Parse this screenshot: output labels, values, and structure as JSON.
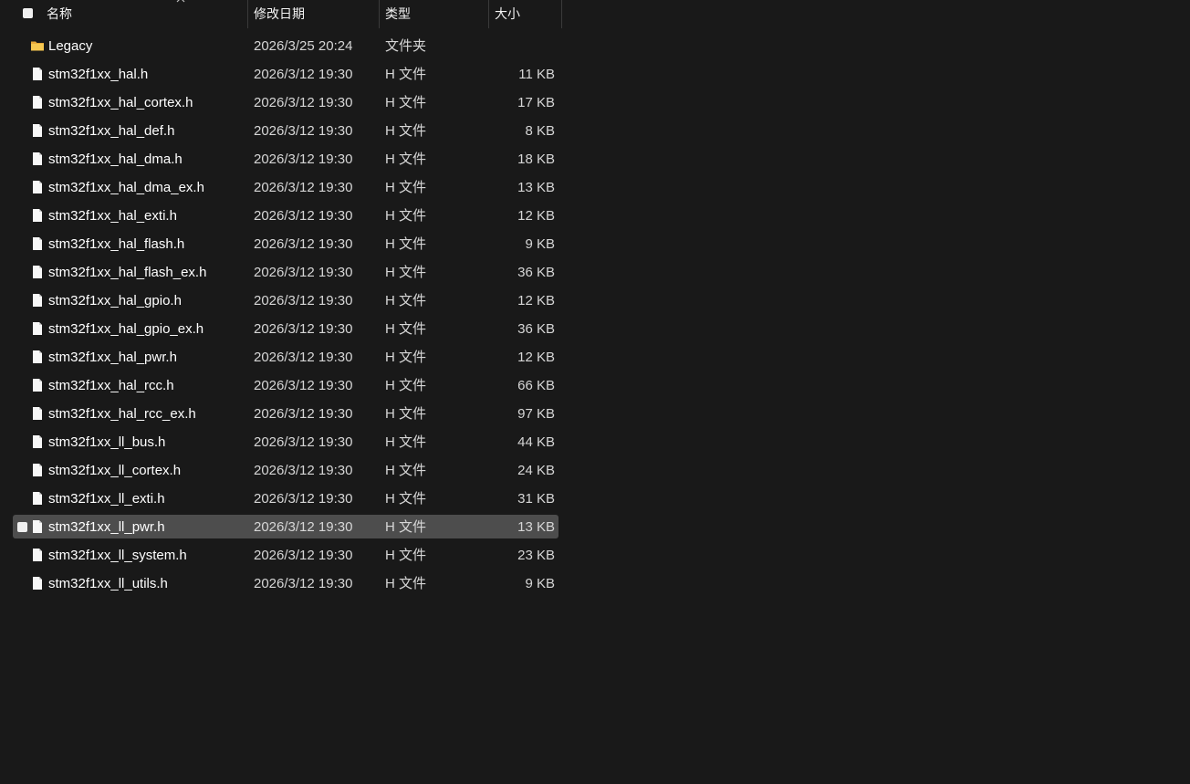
{
  "header": {
    "name": "名称",
    "date": "修改日期",
    "type": "类型",
    "size": "大小"
  },
  "rows": [
    {
      "name": "Legacy",
      "date": "2026/3/25 20:24",
      "type": "文件夹",
      "size": "",
      "icon": "folder-icon"
    },
    {
      "name": "stm32f1xx_hal.h",
      "date": "2026/3/12 19:30",
      "type": "H 文件",
      "size": "11 KB",
      "icon": "file-icon"
    },
    {
      "name": "stm32f1xx_hal_cortex.h",
      "date": "2026/3/12 19:30",
      "type": "H 文件",
      "size": "17 KB",
      "icon": "file-icon"
    },
    {
      "name": "stm32f1xx_hal_def.h",
      "date": "2026/3/12 19:30",
      "type": "H 文件",
      "size": "8 KB",
      "icon": "file-icon"
    },
    {
      "name": "stm32f1xx_hal_dma.h",
      "date": "2026/3/12 19:30",
      "type": "H 文件",
      "size": "18 KB",
      "icon": "file-icon"
    },
    {
      "name": "stm32f1xx_hal_dma_ex.h",
      "date": "2026/3/12 19:30",
      "type": "H 文件",
      "size": "13 KB",
      "icon": "file-icon"
    },
    {
      "name": "stm32f1xx_hal_exti.h",
      "date": "2026/3/12 19:30",
      "type": "H 文件",
      "size": "12 KB",
      "icon": "file-icon"
    },
    {
      "name": "stm32f1xx_hal_flash.h",
      "date": "2026/3/12 19:30",
      "type": "H 文件",
      "size": "9 KB",
      "icon": "file-icon"
    },
    {
      "name": "stm32f1xx_hal_flash_ex.h",
      "date": "2026/3/12 19:30",
      "type": "H 文件",
      "size": "36 KB",
      "icon": "file-icon"
    },
    {
      "name": "stm32f1xx_hal_gpio.h",
      "date": "2026/3/12 19:30",
      "type": "H 文件",
      "size": "12 KB",
      "icon": "file-icon"
    },
    {
      "name": "stm32f1xx_hal_gpio_ex.h",
      "date": "2026/3/12 19:30",
      "type": "H 文件",
      "size": "36 KB",
      "icon": "file-icon"
    },
    {
      "name": "stm32f1xx_hal_pwr.h",
      "date": "2026/3/12 19:30",
      "type": "H 文件",
      "size": "12 KB",
      "icon": "file-icon"
    },
    {
      "name": "stm32f1xx_hal_rcc.h",
      "date": "2026/3/12 19:30",
      "type": "H 文件",
      "size": "66 KB",
      "icon": "file-icon"
    },
    {
      "name": "stm32f1xx_hal_rcc_ex.h",
      "date": "2026/3/12 19:30",
      "type": "H 文件",
      "size": "97 KB",
      "icon": "file-icon"
    },
    {
      "name": "stm32f1xx_ll_bus.h",
      "date": "2026/3/12 19:30",
      "type": "H 文件",
      "size": "44 KB",
      "icon": "file-icon"
    },
    {
      "name": "stm32f1xx_ll_cortex.h",
      "date": "2026/3/12 19:30",
      "type": "H 文件",
      "size": "24 KB",
      "icon": "file-icon"
    },
    {
      "name": "stm32f1xx_ll_exti.h",
      "date": "2026/3/12 19:30",
      "type": "H 文件",
      "size": "31 KB",
      "icon": "file-icon"
    },
    {
      "name": "stm32f1xx_ll_pwr.h",
      "date": "2026/3/12 19:30",
      "type": "H 文件",
      "size": "13 KB",
      "icon": "file-icon",
      "selected": true
    },
    {
      "name": "stm32f1xx_ll_system.h",
      "date": "2026/3/12 19:30",
      "type": "H 文件",
      "size": "23 KB",
      "icon": "file-icon"
    },
    {
      "name": "stm32f1xx_ll_utils.h",
      "date": "2026/3/12 19:30",
      "type": "H 文件",
      "size": "9 KB",
      "icon": "file-icon"
    }
  ],
  "colors": {
    "background": "#191919",
    "selected_row": "#4d4d4d",
    "folder": "#f3c34a",
    "text": "#ffffff",
    "secondary_text": "#d6d6d6"
  }
}
